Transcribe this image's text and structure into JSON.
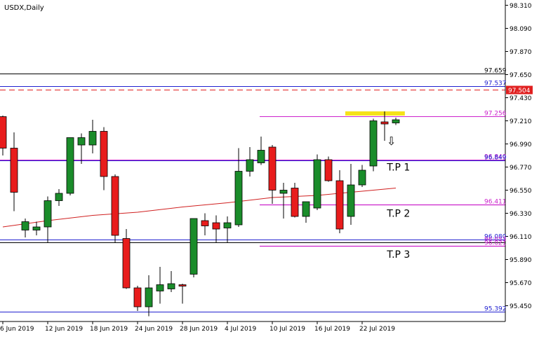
{
  "chart_data": {
    "type": "candlestick",
    "symbol_label": "USDX,Daily",
    "ylim": [
      95.3,
      98.36
    ],
    "y_ticks": [
      "98.310",
      "98.090",
      "97.870",
      "97.650",
      "97.430",
      "97.210",
      "96.990",
      "96.770",
      "96.550",
      "96.330",
      "96.110",
      "95.890",
      "95.670",
      "95.450"
    ],
    "x_ticks": [
      {
        "label": "6 Jun 2019",
        "i": 0
      },
      {
        "label": "12 Jun 2019",
        "i": 4
      },
      {
        "label": "18 Jun 2019",
        "i": 8
      },
      {
        "label": "24 Jun 2019",
        "i": 12
      },
      {
        "label": "28 Jun 2019",
        "i": 16
      },
      {
        "label": "4 Jul 2019",
        "i": 20
      },
      {
        "label": "10 Jul 2019",
        "i": 24
      },
      {
        "label": "16 Jul 2019",
        "i": 28
      },
      {
        "label": "22 Jul 2019",
        "i": 32
      }
    ],
    "candles": [
      {
        "o": 97.25,
        "h": 97.26,
        "l": 96.88,
        "c": 96.95
      },
      {
        "o": 96.95,
        "h": 97.1,
        "l": 96.35,
        "c": 96.53
      },
      {
        "o": 96.17,
        "h": 96.28,
        "l": 96.1,
        "c": 96.25
      },
      {
        "o": 96.17,
        "h": 96.25,
        "l": 96.12,
        "c": 96.2
      },
      {
        "o": 96.2,
        "h": 96.49,
        "l": 96.05,
        "c": 96.45
      },
      {
        "o": 96.45,
        "h": 96.56,
        "l": 96.4,
        "c": 96.52
      },
      {
        "o": 96.52,
        "h": 97.02,
        "l": 96.5,
        "c": 97.05
      },
      {
        "o": 96.98,
        "h": 97.09,
        "l": 96.8,
        "c": 97.05
      },
      {
        "o": 96.98,
        "h": 97.22,
        "l": 96.9,
        "c": 97.11
      },
      {
        "o": 97.11,
        "h": 97.15,
        "l": 96.55,
        "c": 96.68
      },
      {
        "o": 96.68,
        "h": 96.7,
        "l": 96.05,
        "c": 96.12
      },
      {
        "o": 96.09,
        "h": 96.18,
        "l": 95.61,
        "c": 95.62
      },
      {
        "o": 95.62,
        "h": 95.64,
        "l": 95.4,
        "c": 95.44
      },
      {
        "o": 95.44,
        "h": 95.74,
        "l": 95.35,
        "c": 95.62
      },
      {
        "o": 95.59,
        "h": 95.82,
        "l": 95.47,
        "c": 95.65
      },
      {
        "o": 95.61,
        "h": 95.78,
        "l": 95.58,
        "c": 95.66
      },
      {
        "o": 95.65,
        "h": 95.66,
        "l": 95.47,
        "c": 95.64
      },
      {
        "o": 95.75,
        "h": 96.28,
        "l": 95.72,
        "c": 96.28
      },
      {
        "o": 96.26,
        "h": 96.33,
        "l": 96.12,
        "c": 96.21
      },
      {
        "o": 96.24,
        "h": 96.31,
        "l": 96.05,
        "c": 96.18
      },
      {
        "o": 96.19,
        "h": 96.3,
        "l": 96.05,
        "c": 96.24
      },
      {
        "o": 96.22,
        "h": 96.95,
        "l": 96.2,
        "c": 96.73
      },
      {
        "o": 96.73,
        "h": 96.96,
        "l": 96.68,
        "c": 96.84
      },
      {
        "o": 96.81,
        "h": 97.06,
        "l": 96.79,
        "c": 96.93
      },
      {
        "o": 96.96,
        "h": 96.98,
        "l": 96.42,
        "c": 96.55
      },
      {
        "o": 96.52,
        "h": 96.62,
        "l": 96.28,
        "c": 96.55
      },
      {
        "o": 96.57,
        "h": 96.62,
        "l": 96.29,
        "c": 96.3
      },
      {
        "o": 96.3,
        "h": 96.44,
        "l": 96.24,
        "c": 96.44
      },
      {
        "o": 96.38,
        "h": 96.89,
        "l": 96.36,
        "c": 96.84
      },
      {
        "o": 96.84,
        "h": 96.87,
        "l": 96.63,
        "c": 96.64
      },
      {
        "o": 96.64,
        "h": 96.74,
        "l": 96.14,
        "c": 96.18
      },
      {
        "o": 96.3,
        "h": 96.8,
        "l": 96.22,
        "c": 96.6
      },
      {
        "o": 96.6,
        "h": 96.79,
        "l": 96.58,
        "c": 96.74
      },
      {
        "o": 96.78,
        "h": 97.23,
        "l": 96.73,
        "c": 97.21
      },
      {
        "o": 97.2,
        "h": 97.3,
        "l": 97.02,
        "c": 97.18
      },
      {
        "o": 97.19,
        "h": 97.24,
        "l": 97.17,
        "c": 97.22
      }
    ],
    "moving_average": {
      "color": "#d02020",
      "points": [
        {
          "i": 0,
          "v": 96.2
        },
        {
          "i": 4,
          "v": 96.26
        },
        {
          "i": 8,
          "v": 96.31
        },
        {
          "i": 12,
          "v": 96.34
        },
        {
          "i": 16,
          "v": 96.39
        },
        {
          "i": 20,
          "v": 96.43
        },
        {
          "i": 24,
          "v": 96.48
        },
        {
          "i": 28,
          "v": 96.5
        },
        {
          "i": 32,
          "v": 96.54
        },
        {
          "i": 35,
          "v": 96.57
        }
      ]
    },
    "levels": [
      {
        "price": 97.659,
        "label": "97.659",
        "line_color": "#000000",
        "text_color": "#000000",
        "dash": ""
      },
      {
        "price": 97.537,
        "label": "97.537",
        "line_color": "#2020d0",
        "text_color": "#2020d0",
        "dash": ""
      },
      {
        "price": 97.504,
        "label": "97.504",
        "line_color": "#e02020",
        "text_color": "#ffffff",
        "dash": "8,5",
        "badge_color": "#e02020"
      },
      {
        "price": 97.256,
        "label": "97.256",
        "line_color": "#cc22cc",
        "text_color": "#cc22cc",
        "dash": ""
      },
      {
        "price": 96.84,
        "label": "96.840",
        "line_color": "#cc22cc",
        "text_color": "#cc22cc",
        "dash": ""
      },
      {
        "price": 96.832,
        "label": "96.849",
        "line_color": "#2020d0",
        "text_color": "#2020d0",
        "dash": ""
      },
      {
        "price": 96.411,
        "label": "96.411",
        "line_color": "#cc22cc",
        "text_color": "#cc22cc",
        "dash": ""
      },
      {
        "price": 96.08,
        "label": "96.080",
        "line_color": "#2020d0",
        "text_color": "#2020d0",
        "dash": ""
      },
      {
        "price": 96.053,
        "label": "96.053",
        "line_color": "#000000",
        "text_color": "#cc22cc",
        "dash": ""
      },
      {
        "price": 96.02,
        "label": "96.021",
        "line_color": "#cc22cc",
        "text_color": "#cc22cc",
        "dash": ""
      },
      {
        "price": 95.392,
        "label": "95.392",
        "line_color": "#2020d0",
        "text_color": "#2020d0",
        "dash": ""
      }
    ],
    "annotations": [
      {
        "text": "T.P 1",
        "price": 96.77,
        "i": 31.7
      },
      {
        "text": "T.P 2",
        "price": 96.33,
        "i": 31.7
      },
      {
        "text": "T.P 3",
        "price": 95.94,
        "i": 31.7
      }
    ],
    "highlight": {
      "color": "#f5e21a",
      "price_top": 97.3,
      "price_bottom": 97.26,
      "i_start": 30.5,
      "i_end": 35.8
    },
    "arrow": {
      "glyph": "⇩",
      "i": 34.6,
      "price": 97.02
    },
    "colors": {
      "bull": "#1a8c2a",
      "bear": "#e81c1c",
      "wick": "#000000",
      "axis": "#000000",
      "grid_text": "#000000"
    }
  }
}
